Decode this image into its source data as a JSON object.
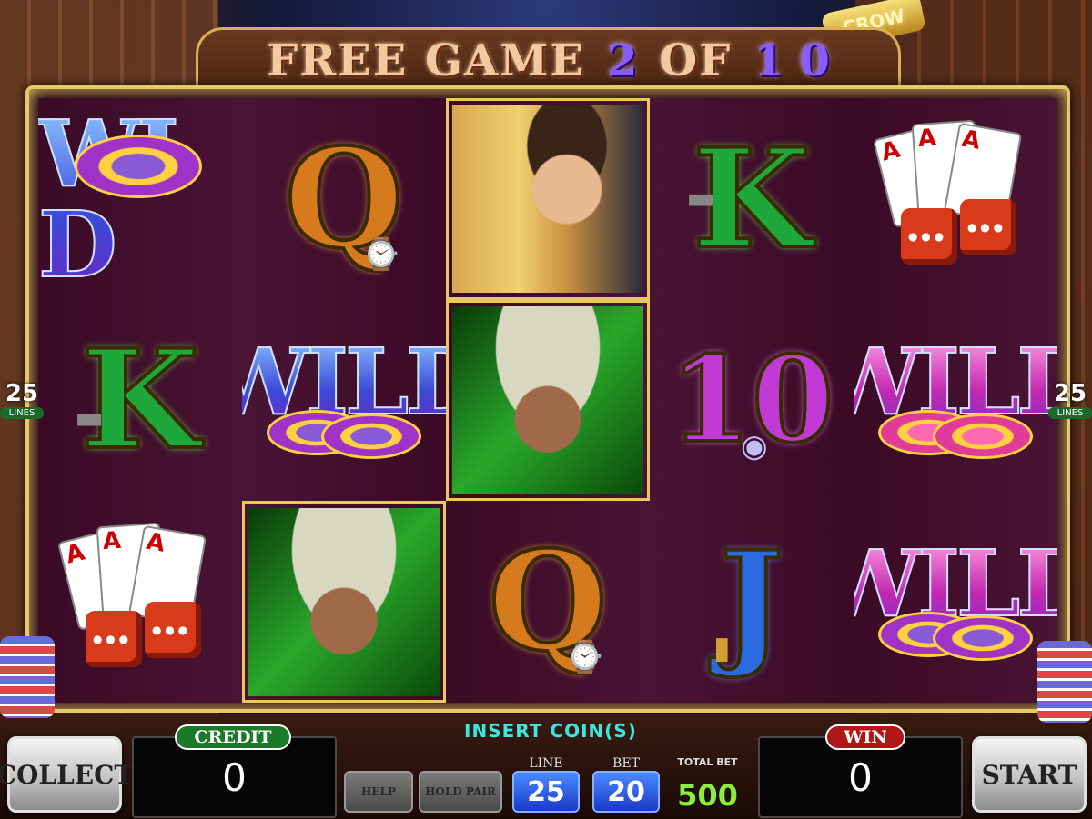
{
  "title": {
    "free_game_label": "FREE GAME",
    "current": "2",
    "of_label": "OF",
    "total": "1 0"
  },
  "sign_text": "CROW",
  "lines_badge": {
    "number": "25",
    "label": "LINES"
  },
  "reels": {
    "row1": [
      "WILD chip",
      "Q",
      "Detective",
      "K",
      "Cards and Dice"
    ],
    "row2": [
      "K",
      "WILD",
      "Gangster",
      "10",
      "WILD"
    ],
    "row3": [
      "Cards and Dice",
      "Gangster",
      "Q",
      "J",
      "WILD"
    ],
    "wild_text": "WILD",
    "wild_corrupt": "WI D",
    "letter_q": "Q",
    "letter_k": "K",
    "letter_j": "J",
    "letter_ten": "10",
    "card_rank": "A"
  },
  "panel": {
    "collect_label": "COLLECT",
    "start_label": "START",
    "credit_label": "CREDIT",
    "credit_value": "0",
    "win_label": "WIN",
    "win_value": "0",
    "insert_coin": "INSERT COIN(S)",
    "help_label": "HELP",
    "hold_pair_label": "HOLD PAIR",
    "line_label": "LINE",
    "line_value": "25",
    "bet_label": "BET",
    "bet_value": "20",
    "total_bet_label": "TOTAL BET",
    "total_bet_value": "500"
  },
  "colors": {
    "frame_gold": "#e8c862",
    "title_purple": "#8a5cff",
    "insert_cyan": "#3ae8e0",
    "total_bet_green": "#8af03a",
    "credit_label_green": "#1a7a2a",
    "win_label_red": "#b01818",
    "selector_blue": "#1a3ac8"
  }
}
